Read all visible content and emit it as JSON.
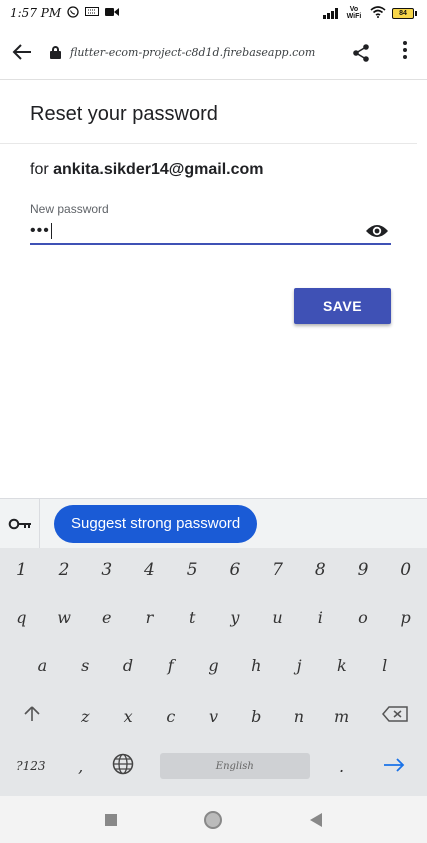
{
  "status_bar": {
    "time": "1:57 PM",
    "vowifi": "Vo WiFi",
    "battery": "84"
  },
  "browser": {
    "url": "flutter-ecom-project-c8d1d.firebaseapp.com"
  },
  "page": {
    "title": "Reset your password",
    "for_label": "for",
    "email": "ankita.sikder14@gmail.com",
    "password_label": "New password",
    "password_value": "•••",
    "save_label": "SAVE",
    "accent_color": "#3f51b5"
  },
  "keyboard": {
    "suggestion": "Suggest strong password",
    "digits": [
      "1",
      "2",
      "3",
      "4",
      "5",
      "6",
      "7",
      "8",
      "9",
      "0"
    ],
    "row1": [
      "q",
      "w",
      "e",
      "r",
      "t",
      "y",
      "u",
      "i",
      "o",
      "p"
    ],
    "row2": [
      "a",
      "s",
      "d",
      "f",
      "g",
      "h",
      "j",
      "k",
      "l"
    ],
    "row3": [
      "z",
      "x",
      "c",
      "v",
      "b",
      "n",
      "m"
    ],
    "symbols_key": "?123",
    "comma": ",",
    "space_label": "English",
    "period": ".",
    "enter_icon": "arrow-right-icon",
    "accent_color": "#1a5bd6"
  }
}
